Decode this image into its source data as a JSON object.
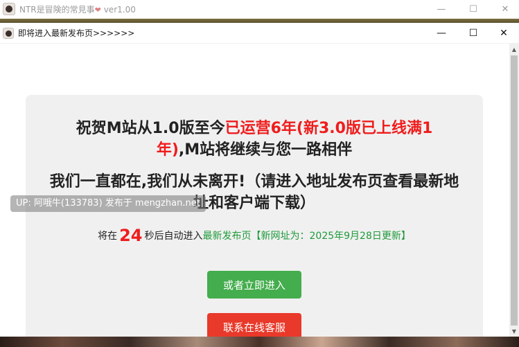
{
  "outer_window": {
    "title": "NTR是冒険的常見事",
    "heart": "❤",
    "version": "ver1.00",
    "minimize": "—",
    "maximize": "☐",
    "close": "✕"
  },
  "inner_window": {
    "title": "即将进入最新发布页>>>>>>",
    "minimize": "—",
    "maximize": "☐",
    "close": "✕"
  },
  "main": {
    "headline_part1": "祝贺M站从1.0版至今",
    "headline_red": "已运营6年(新3.0版已上线满1年)",
    "headline_part2": ",M站将继续与您一路相伴",
    "subhead": "我们一直都在,我们从未离开!（请进入地址发布页查看最新地址和客户端下载）",
    "countdown_prefix": "将在",
    "countdown_seconds": "24",
    "countdown_suffix": "秒后自动进入",
    "latest_page": "最新发布页",
    "update_note": "【新网址为：2025年9月28日更新】",
    "enter_button": "或者立即进入",
    "service_button": "联系在线客服"
  },
  "overlay": {
    "uploader_text": "UP: 阿哦牛(133783) 发布于 mengzhan.net"
  },
  "scrollbar": {
    "up_arrow": "▲",
    "down_arrow": "▼"
  }
}
